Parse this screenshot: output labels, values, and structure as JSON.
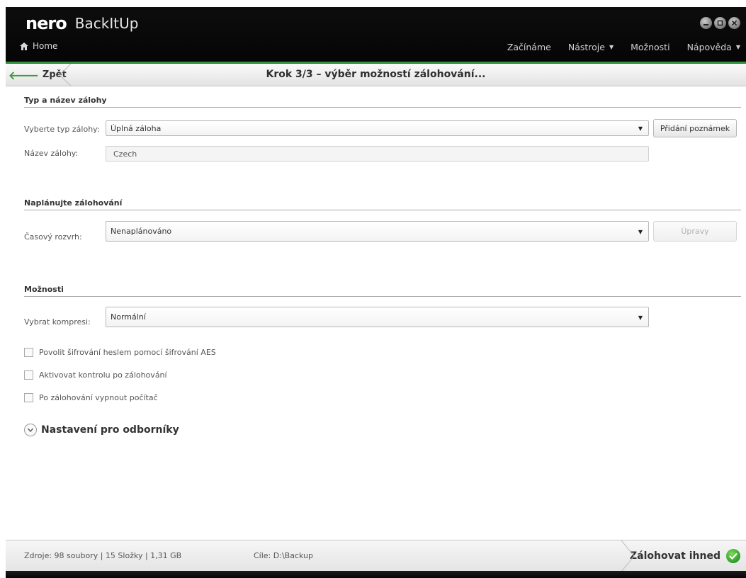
{
  "app": {
    "logo": "nero",
    "name": "BackItUp"
  },
  "nav": {
    "home": "Home",
    "menu": [
      {
        "label": "Začínáme",
        "dropdown": false
      },
      {
        "label": "Nástroje",
        "dropdown": true
      },
      {
        "label": "Možnosti",
        "dropdown": false
      },
      {
        "label": "Nápověda",
        "dropdown": true
      }
    ]
  },
  "stepbar": {
    "back": "Zpět",
    "title": "Krok 3/3 – výběr možností zálohování..."
  },
  "section1": {
    "title": "Typ a název zálohy",
    "type_label": "Vyberte typ zálohy:",
    "type_value": "Úplná záloha",
    "notes_button": "Přidání poznámek",
    "name_label": "Název zálohy:",
    "name_value": "Czech"
  },
  "section2": {
    "title": "Naplánujte zálohování",
    "schedule_label": "Časový rozvrh:",
    "schedule_value": "Nenaplánováno",
    "edit_button": "Úpravy"
  },
  "section3": {
    "title": "Možnosti",
    "compression_label": "Vybrat kompresi:",
    "compression_value": "Normální",
    "checks": [
      "Povolit šifrování heslem pomocí šifrování AES",
      "Aktivovat kontrolu po zálohování",
      "Po zálohování vypnout počítač"
    ],
    "expander": "Nastavení pro odborníky"
  },
  "status": {
    "source": "Zdroje: 98 soubory | 15 Složky | 1,31 GB",
    "destination": "Cíle: D:\\Backup",
    "backup_now": "Zálohovat ihned"
  },
  "colors": {
    "accent": "#3aa64a",
    "titlebar": "#0b0b0b"
  }
}
